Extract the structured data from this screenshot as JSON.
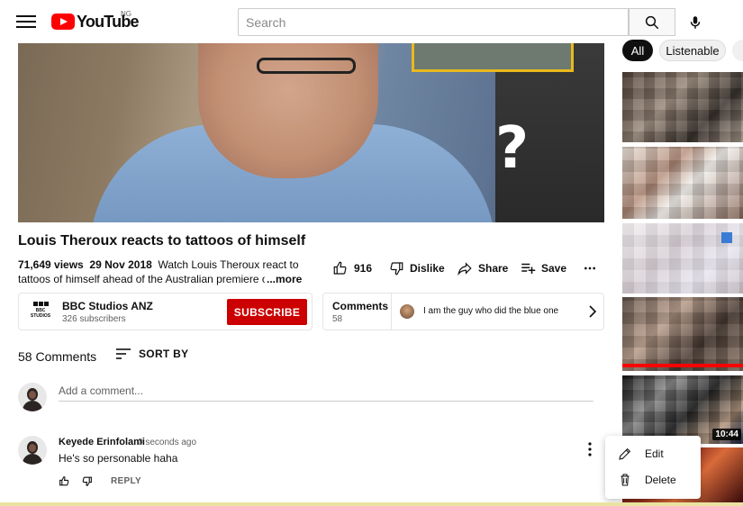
{
  "header": {
    "logo_text": "YouTube",
    "region": "NG",
    "search_placeholder": "Search"
  },
  "chips": [
    "All",
    "Listenable"
  ],
  "video": {
    "title": "Louis Theroux reacts to tattoos of himself",
    "views": "71,649 views",
    "date": "29 Nov 2018",
    "description": "Watch Louis Theroux react to tattoos of himself ahead of the Australian premiere of",
    "more_label": "...more",
    "likes": "916",
    "dislike_label": "Dislike",
    "share_label": "Share",
    "save_label": "Save"
  },
  "channel": {
    "logo_text": "BBC STUDIOS",
    "name": "BBC Studios ANZ",
    "subscribers": "326 subscribers",
    "subscribe_label": "SUBSCRIBE"
  },
  "comments_teaser": {
    "label": "Comments",
    "count": "58",
    "top_comment": "I am the guy who did the blue one"
  },
  "comments": {
    "count_label": "58 Comments",
    "sort_label": "SORT BY",
    "add_placeholder": "Add a comment...",
    "items": [
      {
        "author": "Keyede Erinfolami",
        "time": "0 seconds ago",
        "text": "He's so personable haha",
        "reply_label": "REPLY"
      }
    ]
  },
  "context_menu": {
    "items": [
      "Edit",
      "Delete"
    ]
  },
  "sidebar": {
    "durations": [
      "10:44"
    ]
  },
  "colors": {
    "brand_red": "#ff0000",
    "subscribe_red": "#cc0000",
    "chip_active": "#0f0f0f"
  }
}
